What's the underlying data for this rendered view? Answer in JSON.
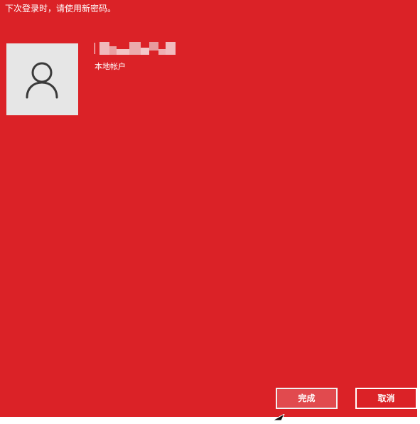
{
  "dialog": {
    "instruction": "下次登录时，请使用新密码。",
    "background_color": "#db2227"
  },
  "account": {
    "avatar_icon": "user-icon",
    "username_redacted": true,
    "account_type": "本地帐户"
  },
  "buttons": {
    "finish_label": "完成",
    "cancel_label": "取消"
  },
  "cursor_icon": "mouse-pointer-icon"
}
